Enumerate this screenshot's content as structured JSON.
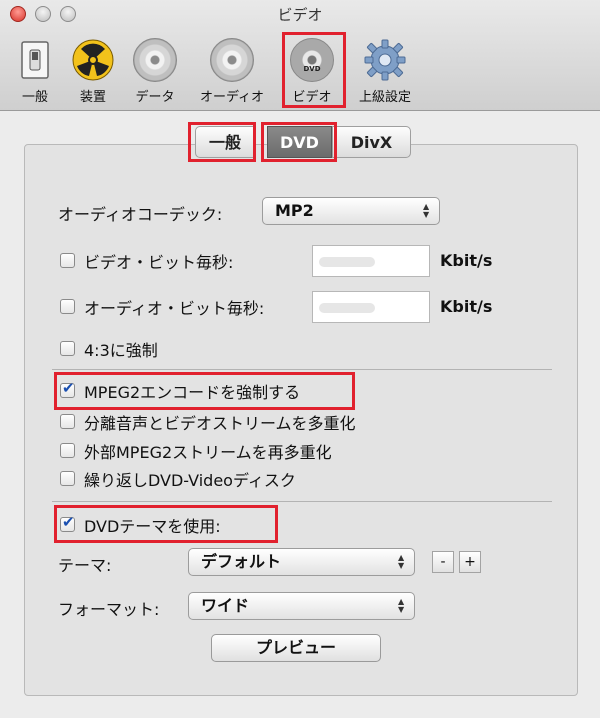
{
  "window": {
    "title": "ビデオ"
  },
  "toolbar": {
    "items": [
      {
        "label": "一般",
        "icon": "switch-icon"
      },
      {
        "label": "装置",
        "icon": "radiation-icon"
      },
      {
        "label": "データ",
        "icon": "data-disc-icon"
      },
      {
        "label": "オーディオ",
        "icon": "audio-disc-icon"
      },
      {
        "label": "ビデオ",
        "icon": "dvd-disc-icon",
        "disc_text": "DVD",
        "selected": true
      },
      {
        "label": "上級設定",
        "icon": "gear-icon"
      }
    ]
  },
  "tabs": [
    {
      "label": "一般",
      "selected": false
    },
    {
      "label": "DVD",
      "selected": true
    },
    {
      "label": "DivX",
      "selected": false
    }
  ],
  "audio_codec": {
    "label": "オーディオコーデック:",
    "value": "MP2"
  },
  "video_bitrate": {
    "label": "ビデオ・ビット毎秒:",
    "unit": "Kbit/s",
    "checked": false
  },
  "audio_bitrate": {
    "label": "オーディオ・ビット毎秒:",
    "unit": "Kbit/s",
    "checked": false
  },
  "force_43": {
    "label": "4:3に強制",
    "checked": false
  },
  "mpeg2_options": [
    {
      "label": "MPEG2エンコードを強制する",
      "checked": true
    },
    {
      "label": "分離音声とビデオストリームを多重化",
      "checked": false
    },
    {
      "label": "外部MPEG2ストリームを再多重化",
      "checked": false
    },
    {
      "label": "繰り返しDVD-Videoディスク",
      "checked": false
    }
  ],
  "dvd_theme": {
    "label": "DVDテーマを使用:",
    "checked": true,
    "theme_label": "テーマ:",
    "theme_value": "デフォルト",
    "minus": "-",
    "plus": "+",
    "format_label": "フォーマット:",
    "format_value": "ワイド",
    "preview_button": "プレビュー"
  },
  "colors": {
    "highlight": "#e1212e",
    "selected_tab": "#6c6c6c"
  }
}
